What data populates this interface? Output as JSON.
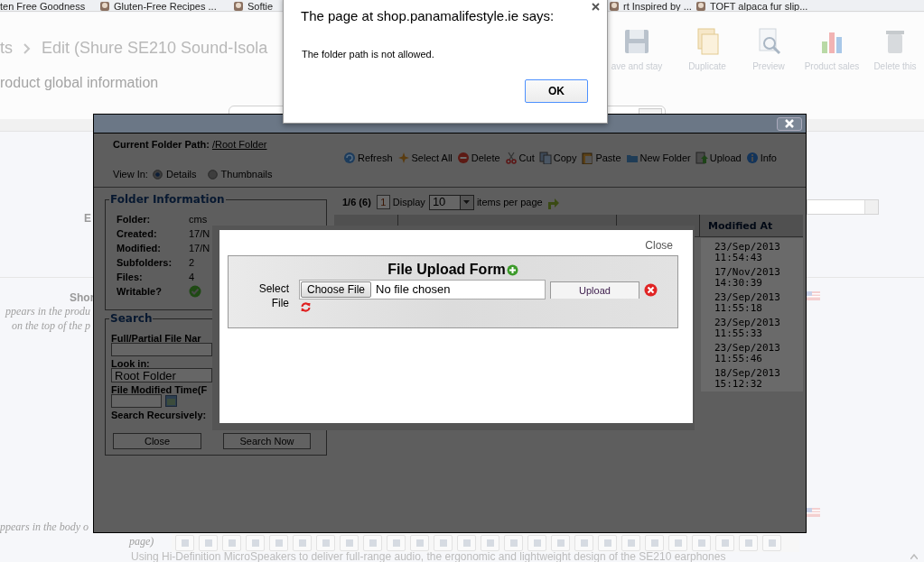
{
  "bookmarks": [
    {
      "label": "ten Free Goodness",
      "favicon": false
    },
    {
      "label": "Gluten-Free Recipes ...",
      "favicon": true
    },
    {
      "label": "Softie",
      "favicon": true
    },
    {
      "label": "rt Inspired by ...",
      "favicon": true
    },
    {
      "label": "TOFT alpaca fur slip...",
      "favicon": true
    }
  ],
  "page": {
    "breadcrumb_prev": "ts",
    "breadcrumb_current": "Edit (Shure SE210 Sound-Isola",
    "toolbar": [
      {
        "label": "ave and stay",
        "kind": "save"
      },
      {
        "label": "Duplicate",
        "kind": "duplicate"
      },
      {
        "label": "Preview",
        "kind": "preview"
      },
      {
        "label": "Product sales",
        "kind": "sales"
      },
      {
        "label": "Delete this",
        "kind": "delete"
      }
    ],
    "section_title": "roduct global information",
    "field_label": "E",
    "short_label": "Shor",
    "short_hint": "ppears in the produ on the top of the p",
    "desc_hint": "ppears in the body o",
    "desc_hint_end": "page)",
    "editor_text": "Using Hi-Definition MicroSpeakers to deliver full-range audio, the ergonomic and lightweight design of the SE210 earphones"
  },
  "file_manager": {
    "path_label": "Current Folder Path:",
    "path": "/Root Folder",
    "view_label": "View In:",
    "views": [
      {
        "label": "Details",
        "selected": true
      },
      {
        "label": "Thumbnails",
        "selected": false
      }
    ],
    "toolbar": [
      {
        "label": "Refresh",
        "kind": "refresh"
      },
      {
        "label": "Select All",
        "kind": "select_all"
      },
      {
        "label": "Delete",
        "kind": "delete"
      },
      {
        "label": "Cut",
        "kind": "cut"
      },
      {
        "label": "Copy",
        "kind": "copy"
      },
      {
        "label": "Paste",
        "kind": "paste"
      },
      {
        "label": "New Folder",
        "kind": "new_folder"
      },
      {
        "label": "Upload",
        "kind": "upload"
      },
      {
        "label": "Info",
        "kind": "info"
      }
    ],
    "folder_info": {
      "title": "Folder Information",
      "rows": [
        {
          "label": "Folder:",
          "value": "cms"
        },
        {
          "label": "Created:",
          "value": "17/N"
        },
        {
          "label": "Modified:",
          "value": "17/N"
        },
        {
          "label": "Subfolders:",
          "value": "2"
        },
        {
          "label": "Files:",
          "value": "4"
        }
      ],
      "writable_label": "Writable?",
      "writable": true
    },
    "search": {
      "title": "Search",
      "name_label": "Full/Partial File Nar",
      "look_in_label": "Look in:",
      "look_in": "Root Folder",
      "time_label": "File Modified Time(F",
      "recursive_label": "Search Recursively:",
      "buttons": [
        "Close",
        "Search Now"
      ]
    },
    "pager": {
      "count": "1/6 (6)",
      "page": "1",
      "display_label": "Display",
      "per_page": "10",
      "suffix": "items per page"
    },
    "table": {
      "modified_header": "Modified At",
      "modified": [
        "23/Sep/2013 11:54:43",
        "17/Nov/2013 14:30:39",
        "23/Sep/2013 11:55:18",
        "23/Sep/2013 11:55:33",
        "23/Sep/2013 11:55:46",
        "18/Sep/2013 15:12:32"
      ]
    }
  },
  "upload_form": {
    "close": "Close",
    "title": "File Upload Form",
    "file_label": "Select File",
    "choose_button": "Choose File",
    "file_status": "No file chosen",
    "upload_button": "Upload"
  },
  "alert": {
    "title": "The page at shop.panamalifestyle.ie says:",
    "message": "The folder path is not allowed.",
    "ok": "OK"
  }
}
